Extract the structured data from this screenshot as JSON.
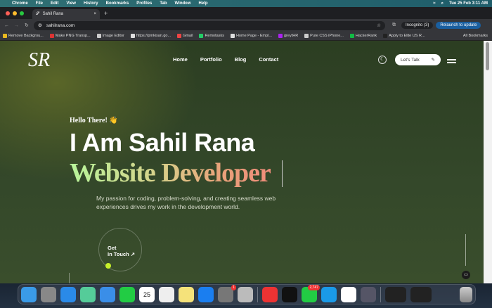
{
  "menubar": {
    "items": [
      "Chrome",
      "File",
      "Edit",
      "View",
      "History",
      "Bookmarks",
      "Profiles",
      "Tab",
      "Window",
      "Help"
    ],
    "clock": "Tue 25 Feb 3:11 AM"
  },
  "browser": {
    "tab_title": "Sahil Rana",
    "url": "sahilrana.com",
    "incognito": "Incognito (3)",
    "relaunch": "Relaunch to update",
    "bookmarks": [
      {
        "label": "Remove Backgrou...",
        "color": "#e8b820"
      },
      {
        "label": "Make PNG Transp...",
        "color": "#d33"
      },
      {
        "label": "Image Editor",
        "color": "#ccc"
      },
      {
        "label": "https://pmkisan.go...",
        "color": "#ddd"
      },
      {
        "label": "Gmail",
        "color": "#e44"
      },
      {
        "label": "Remotasks",
        "color": "#2c6"
      },
      {
        "label": "Home Page - Empl...",
        "color": "#ddd"
      },
      {
        "label": "greytHR",
        "color": "#a2e"
      },
      {
        "label": "Pure CSS iPhone...",
        "color": "#ccc"
      },
      {
        "label": "HackerRank",
        "color": "#1b4"
      },
      {
        "label": "Apply to Elite US R...",
        "color": "#222"
      }
    ],
    "all_bookmarks": "All Bookmarks"
  },
  "site": {
    "logo": "SR",
    "nav": [
      "Home",
      "Portfolio",
      "Blog",
      "Contact"
    ],
    "cta": "Let's Talk",
    "hello": "Hello There! 👋",
    "name": "I Am Sahil Rana",
    "role": "Website Developer",
    "description": "My passion for coding, problem-solving, and creating seamless web experiences drives my work in the development world.",
    "get_in_touch_1": "Get",
    "get_in_touch_2": "In Touch ↗"
  },
  "dock": {
    "apps": [
      {
        "name": "finder",
        "color": "#3a9be8"
      },
      {
        "name": "launchpad",
        "color": "#888"
      },
      {
        "name": "safari",
        "color": "#2a8ae8"
      },
      {
        "name": "maps",
        "color": "#5c9"
      },
      {
        "name": "mail",
        "color": "#3a8ee8"
      },
      {
        "name": "facetime",
        "color": "#2c4"
      },
      {
        "name": "calendar",
        "color": "#fff",
        "text": "25"
      },
      {
        "name": "chrome",
        "color": "#eee"
      },
      {
        "name": "notes",
        "color": "#f5e27a"
      },
      {
        "name": "app-store",
        "color": "#1a7ef0"
      },
      {
        "name": "system-settings",
        "color": "#777",
        "badge": "1"
      },
      {
        "name": "iphone-mirroring",
        "color": "#bbb"
      }
    ],
    "apps2": [
      {
        "name": "anydesk",
        "color": "#e33"
      },
      {
        "name": "terminal",
        "color": "#111"
      },
      {
        "name": "messages",
        "color": "#2c4",
        "badge": "2,747"
      },
      {
        "name": "skype",
        "color": "#1a9ae8"
      },
      {
        "name": "vscode",
        "color": "#fff"
      },
      {
        "name": "quicktime",
        "color": "#556"
      }
    ]
  }
}
